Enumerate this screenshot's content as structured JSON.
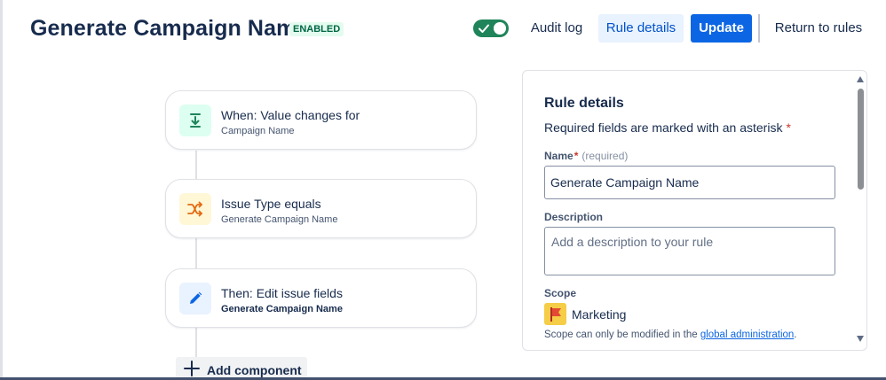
{
  "header": {
    "title": "Generate Campaign Name",
    "status_badge": "ENABLED",
    "toggle_on": true,
    "audit_log_label": "Audit log",
    "rule_details_label": "Rule details",
    "update_label": "Update",
    "return_label": "Return to rules"
  },
  "flow": {
    "cards": [
      {
        "title": "When: Value changes for",
        "subtitle": "Campaign Name",
        "icon": "download-arrow-icon",
        "color": "#1f845a"
      },
      {
        "title": "Issue Type equals",
        "subtitle": "Generate Campaign Name",
        "icon": "shuffle-icon",
        "color": "#e56910"
      },
      {
        "title": "Then: Edit issue fields",
        "subtitle": "Generate Campaign Name",
        "icon": "pencil-icon",
        "color": "#0c66e4"
      }
    ],
    "add_component_label": "Add component"
  },
  "panel": {
    "title": "Rule details",
    "required_note": "Required fields are marked with an asterisk",
    "asterisk": "*",
    "name_label": "Name",
    "name_required": "(required)",
    "name_value": "Generate Campaign Name",
    "description_label": "Description",
    "description_placeholder": "Add a description to your rule",
    "scope_label": "Scope",
    "scope_value": "Marketing",
    "scope_note_prefix": "Scope can only be modified in the ",
    "scope_note_link": "global administration",
    "scope_note_suffix": "."
  },
  "colors": {
    "accent": "#0c66e4",
    "toggle_on": "#1f845a",
    "badge_bg": "#e3fcef",
    "badge_text": "#006644"
  }
}
